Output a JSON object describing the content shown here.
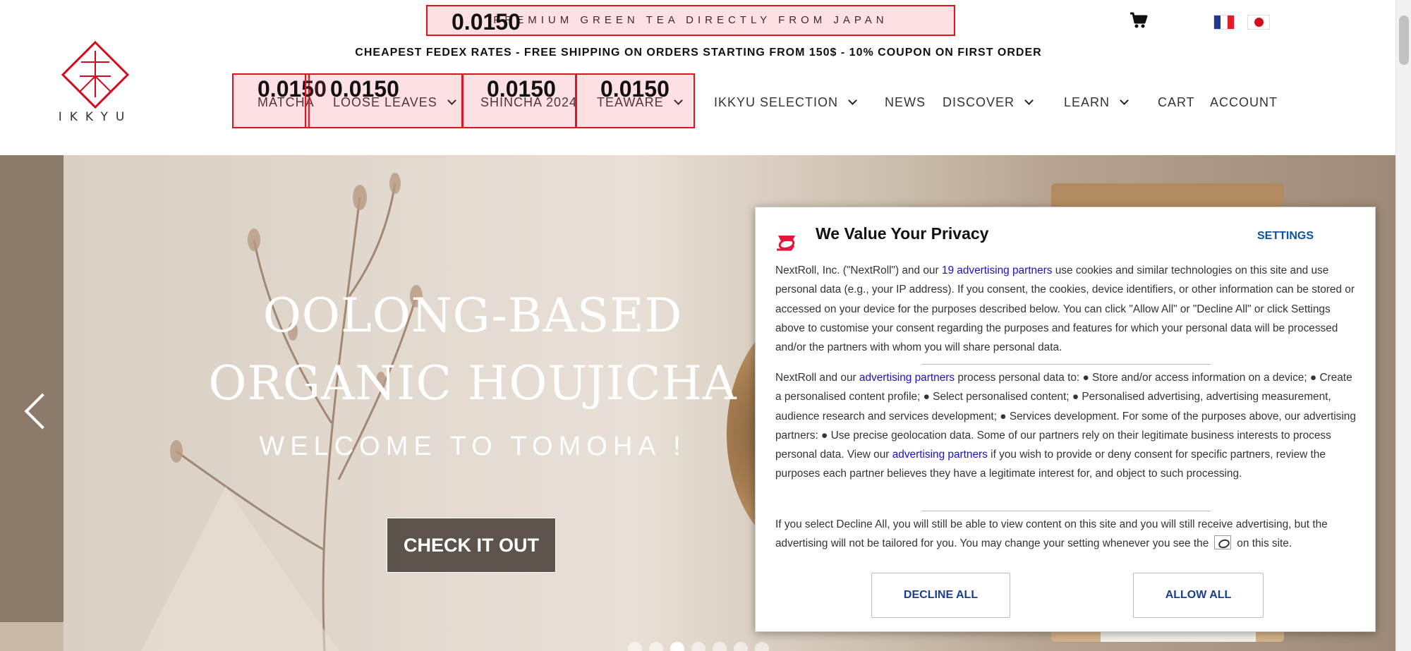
{
  "brand": {
    "logo_text": "IKKYU"
  },
  "top_bar": {
    "promo": "PREMIUM GREEN TEA DIRECTLY FROM JAPAN",
    "shipping": "CHEAPEST FEDEX RATES - FREE SHIPPING ON ORDERS STARTING FROM 150$ - 10% COUPON ON FIRST ORDER"
  },
  "nav": {
    "items": [
      {
        "label": "MATCHA",
        "has_dropdown": false
      },
      {
        "label": "LOOSE LEAVES",
        "has_dropdown": true
      },
      {
        "label": "SHINCHA 2024",
        "has_dropdown": false
      },
      {
        "label": "TEAWARE",
        "has_dropdown": true
      },
      {
        "label": "IKKYU SELECTION",
        "has_dropdown": true
      },
      {
        "label": "NEWS",
        "has_dropdown": false
      },
      {
        "label": "DISCOVER",
        "has_dropdown": true
      },
      {
        "label": "LEARN",
        "has_dropdown": true
      },
      {
        "label": "CART",
        "has_dropdown": false
      },
      {
        "label": "ACCOUNT",
        "has_dropdown": false
      }
    ]
  },
  "overlay_labels": {
    "promo": "0.0150",
    "matcha": "0.0150",
    "loose_leaves": "0.0150",
    "shincha": "0.0150",
    "teaware": "0.0150"
  },
  "icons": {
    "cart": "cart-icon",
    "flag_fr": "flag-fr-icon",
    "flag_jp": "flag-jp-icon",
    "prev": "chevron-left-icon",
    "nextroll": "nextroll-logo-icon"
  },
  "colors": {
    "overlay_border": "#e0141e",
    "logo_red": "#d10a1e",
    "modal_link": "#1a0fd0",
    "modal_button_text": "#1a3f8e"
  },
  "hero": {
    "title_line1": "OOLONG-BASED",
    "title_line2": "ORGANIC HOUJICHA",
    "subtitle": "WELCOME TO TOMOHA !",
    "button": "CHECK IT OUT",
    "slide_count": 7,
    "active_slide": 3
  },
  "privacy": {
    "title": "We Value Your Privacy",
    "settings": "SETTINGS",
    "p1_start": "NextRoll, Inc. (\"NextRoll\") and our ",
    "p1_link": "19 advertising partners",
    "p1_end": " use cookies and similar technologies on this site and use personal data (e.g., your IP address). If you consent, the cookies, device identifiers, or other information can be stored or accessed on your device for the purposes described below. You can click \"Allow All\" or \"Decline All\" or click Settings above to customise your consent regarding the purposes and features for which your personal data will be processed and/or the partners with whom you will share personal data.",
    "p2_start": "NextRoll and our ",
    "p2_link1": "advertising partners",
    "p2_mid": " process personal data to: ● Store and/or access information on a device; ● Create a personalised content profile; ● Select personalised content; ● Personalised advertising, advertising measurement, audience research and services development; ● Services development. For some of the purposes above, our advertising partners: ● Use precise geolocation data. Some of our partners rely on their legitimate business interests to process personal data. View our ",
    "p2_link2": "advertising partners",
    "p2_end": " if you wish to provide or deny consent for specific partners, review the purposes each partner believes they have a legitimate interest for, and object to such processing.",
    "p3_start": "If you select Decline All, you will still be able to view content on this site and you will still receive advertising, but the advertising will not be tailored for you. You may change your setting whenever you see the",
    "p3_end": "on this site.",
    "decline": "DECLINE ALL",
    "allow": "ALLOW ALL"
  }
}
